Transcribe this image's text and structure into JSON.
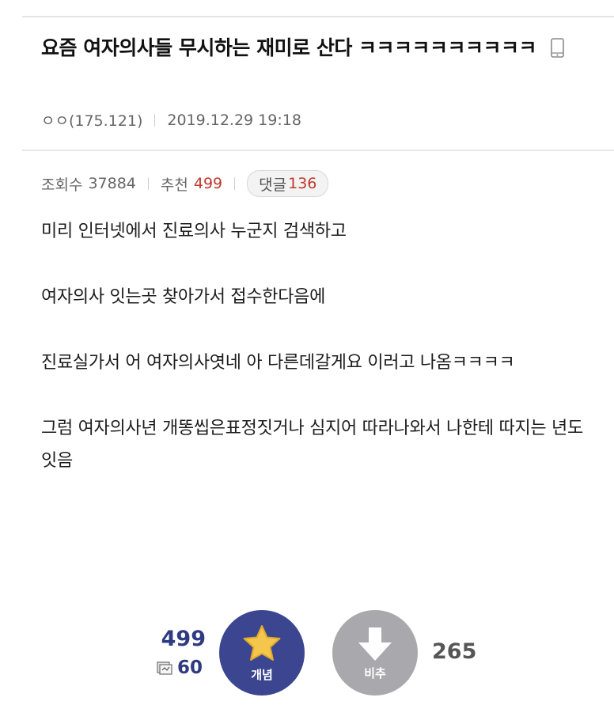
{
  "post": {
    "title": "요즘 여자의사들 무시하는 재미로 산다 ㅋㅋㅋㅋㅋㅋㅋㅋㅋㅋ",
    "writer": "ㅇㅇ(175.121)",
    "date": "2019.12.29 19:18",
    "mobile_icon": "mobile-phone-icon"
  },
  "stats": {
    "views_label": "조회수",
    "views": "37884",
    "recommend_label": "추천",
    "recommend": "499",
    "reply_label": "댓글",
    "reply_count": "136"
  },
  "body": [
    "미리 인터넷에서 진료의사 누군지 검색하고",
    "여자의사 잇는곳 찾아가서 접수한다음에",
    "진료실가서 어 여자의사엿네 아 다른데갈게요 이러고 나옴ㅋㅋㅋㅋ",
    "그럼 여자의사년 개똥씹은표정짓거나 심지어 따라나와서 나한테 따지는 년도잇음"
  ],
  "vote": {
    "up_count": "499",
    "fixed_count": "60",
    "up_label": "개념",
    "down_label": "비추",
    "down_count": "265",
    "up_color": "#3c4690",
    "down_color": "#a9a9ad",
    "star_color": "#f5c64c"
  }
}
